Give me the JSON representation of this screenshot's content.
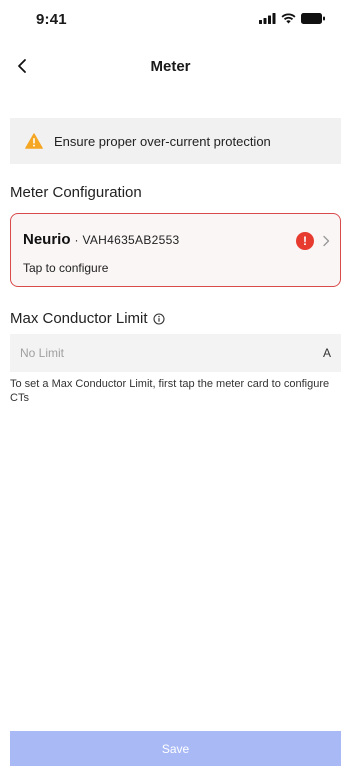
{
  "status_bar": {
    "time": "9:41",
    "icons": [
      "signal-icon",
      "wifi-icon",
      "battery-icon"
    ]
  },
  "nav": {
    "title": "Meter",
    "back_icon": "chevron-left-icon"
  },
  "warning": {
    "icon": "warning-triangle-icon",
    "text": "Ensure proper over-current protection",
    "icon_color": "#f5a623"
  },
  "meter_configuration": {
    "title": "Meter Configuration",
    "card": {
      "brand": "Neurio",
      "serial": "· VAH4635AB2553",
      "hint": "Tap to configure",
      "status_icon": "error-icon",
      "status_glyph": "!",
      "border_color": "#d94a4a"
    }
  },
  "max_conductor": {
    "title": "Max Conductor Limit",
    "info_icon": "info-icon",
    "placeholder": "No Limit",
    "unit": "A",
    "helper": "To set a Max Conductor Limit, first tap the meter card to configure CTs"
  },
  "footer": {
    "save_label": "Save",
    "save_color": "#a9b9f6"
  }
}
